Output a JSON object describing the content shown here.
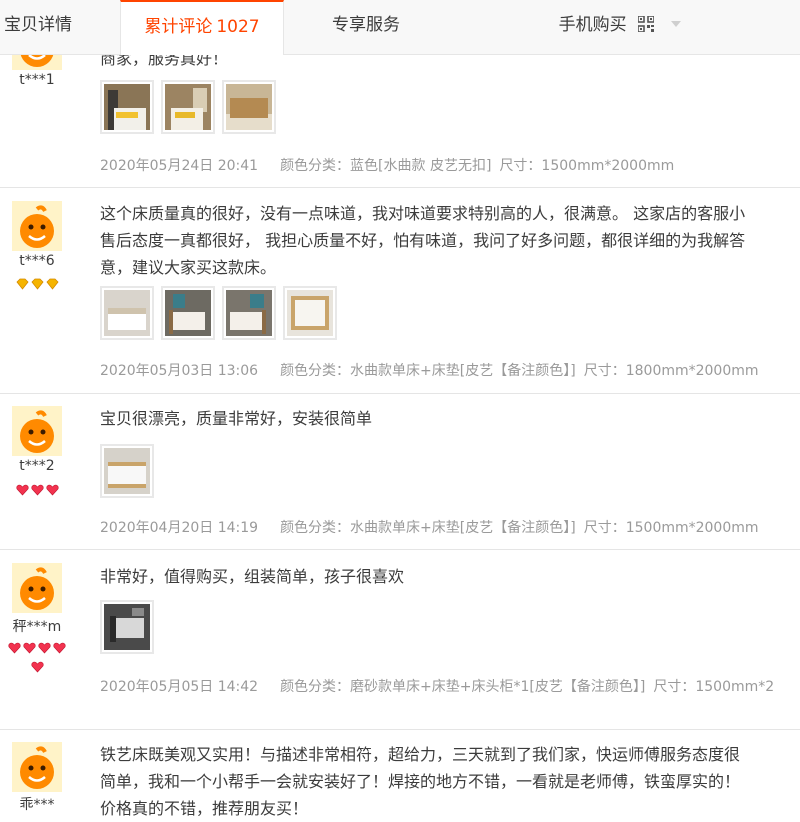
{
  "tabs": {
    "details": "宝贝详情",
    "reviews_label": "累计评论",
    "reviews_count": "1027",
    "service": "专享服务",
    "mobile": "手机购买"
  },
  "colors": {
    "accent": "#ff4400",
    "meta": "#9a9a9a",
    "text": "#3c3c3c"
  },
  "reviews": [
    {
      "user": "t***1",
      "text": "商家，服务真好！",
      "photos": [
        "bedroom-photo",
        "bedroom-photo",
        "bed-frame-photo"
      ],
      "date": "2020年05月24日 20:41",
      "sku": "颜色分类：蓝色[水曲款 皮艺无扣]",
      "size": "尺寸：1500mm*2000mm"
    },
    {
      "user": "t***6",
      "badge": "gold-diamond",
      "badge_count": 3,
      "text": "这个床质量真的很好，没有一点味道，我对味道要求特别高的人，很满意。 这家店的客服小\n售后态度一真都很好， 我担心质量不好，怕有味道，我问了好多问题，都很详细的为我解答\n意，建议大家买这款床。",
      "photos": [
        "bed-photo",
        "bed-photo",
        "bed-photo",
        "headboard-photo"
      ],
      "date": "2020年05月03日 13:06",
      "sku": "颜色分类：水曲款单床+床垫[皮艺【备注颜色】]",
      "size": "尺寸：1800mm*2000mm"
    },
    {
      "user": "t***2",
      "badge": "red-heart",
      "badge_count": 3,
      "text": "宝贝很漂亮，质量非常好，安装很简单",
      "photos": [
        "bed-photo"
      ],
      "date": "2020年04月20日 14:19",
      "sku": "颜色分类：水曲款单床+床垫[皮艺【备注颜色】]",
      "size": "尺寸：1500mm*2000mm"
    },
    {
      "user": "秤***m",
      "badge": "red-heart",
      "badge_count": 5,
      "text": "非常好，值得购买，组装简单，孩子很喜欢",
      "photos": [
        "dark-bed-photo"
      ],
      "date": "2020年05月05日 14:42",
      "sku": "颜色分类：磨砂款单床+床垫+床头柜*1[皮艺【备注颜色】]",
      "size": "尺寸：1500mm*2"
    },
    {
      "user": "乖***",
      "text": "铁艺床既美观又实用！与描述非常相符，超给力，三天就到了我们家，快运师傅服务态度很\n简单，我和一个小帮手一会就安装好了！焊接的地方不错，一看就是老师傅，铁蛮厚实的！\n价格真的不错，推荐朋友买！",
      "photos": [],
      "date": "",
      "sku": "",
      "size": ""
    }
  ]
}
